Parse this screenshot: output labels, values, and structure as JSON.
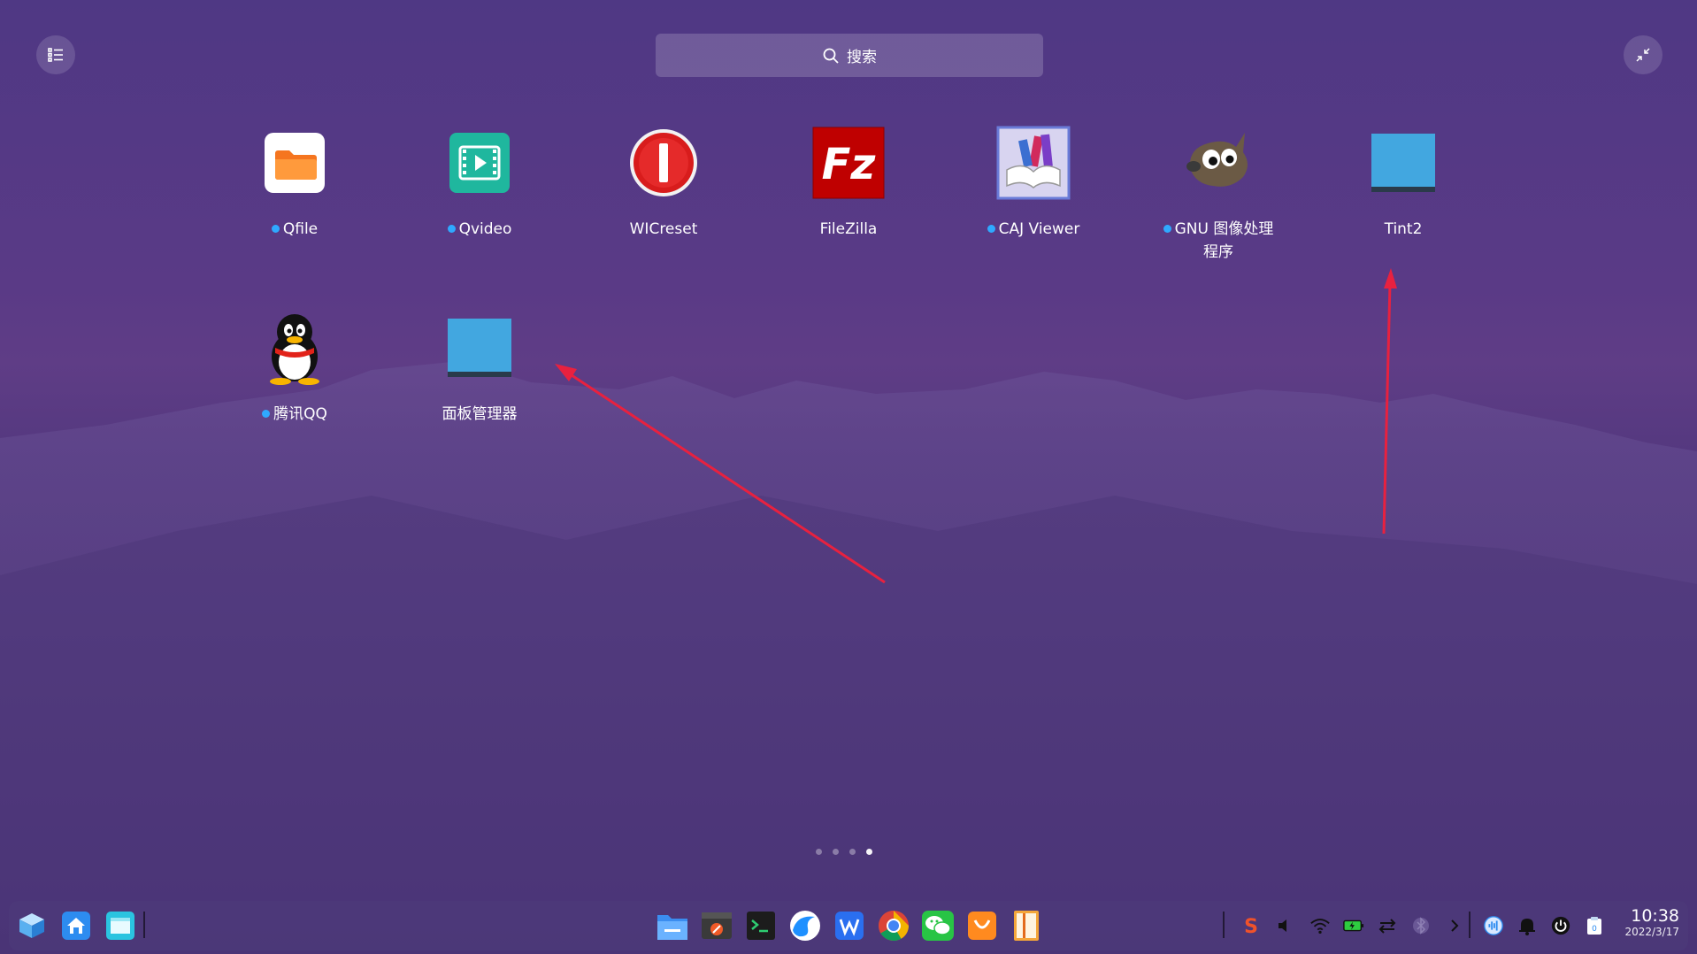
{
  "search": {
    "label": "搜索",
    "icon": "search-icon"
  },
  "apps": [
    {
      "name": "Qfile",
      "new": true,
      "icon": "folder-icon"
    },
    {
      "name": "Qvideo",
      "new": true,
      "icon": "video-player-icon"
    },
    {
      "name": "WICreset",
      "new": false,
      "icon": "wicreset-icon"
    },
    {
      "name": "FileZilla",
      "new": false,
      "icon": "filezilla-icon"
    },
    {
      "name": "CAJ Viewer",
      "new": true,
      "icon": "caj-viewer-icon"
    },
    {
      "name": "GNU 图像处理程序",
      "new": true,
      "icon": "gimp-icon"
    },
    {
      "name": "Tint2",
      "new": false,
      "icon": "generic-app-icon"
    },
    {
      "name": "腾讯QQ",
      "new": true,
      "icon": "qq-penguin-icon"
    },
    {
      "name": "面板管理器",
      "new": false,
      "icon": "generic-app-icon"
    }
  ],
  "pager": {
    "count": 4,
    "active": 4
  },
  "colors": {
    "accent_dot": "#2fa9ff",
    "arrow": "#e8213f",
    "generic_icon": "#42a7e0"
  },
  "taskbar": {
    "left_icons": [
      "launcher-cube-icon",
      "home-icon",
      "multitask-view-icon"
    ],
    "center_icons": [
      "file-manager-icon",
      "screen-recorder-icon",
      "terminal-icon",
      "browser-icon",
      "wps-writer-icon",
      "chrome-icon",
      "wechat-icon",
      "app-store-icon",
      "ebook-reader-icon"
    ],
    "tray_icons": [
      "sogou-input-icon",
      "volume-icon",
      "wifi-icon",
      "battery-icon",
      "network-transfer-icon",
      "bluetooth-icon",
      "chevron-right-icon",
      "voice-assistant-icon",
      "bell-icon",
      "power-icon",
      "clipboard-icon"
    ],
    "clock": {
      "time": "10:38",
      "date": "2022/3/17"
    }
  }
}
